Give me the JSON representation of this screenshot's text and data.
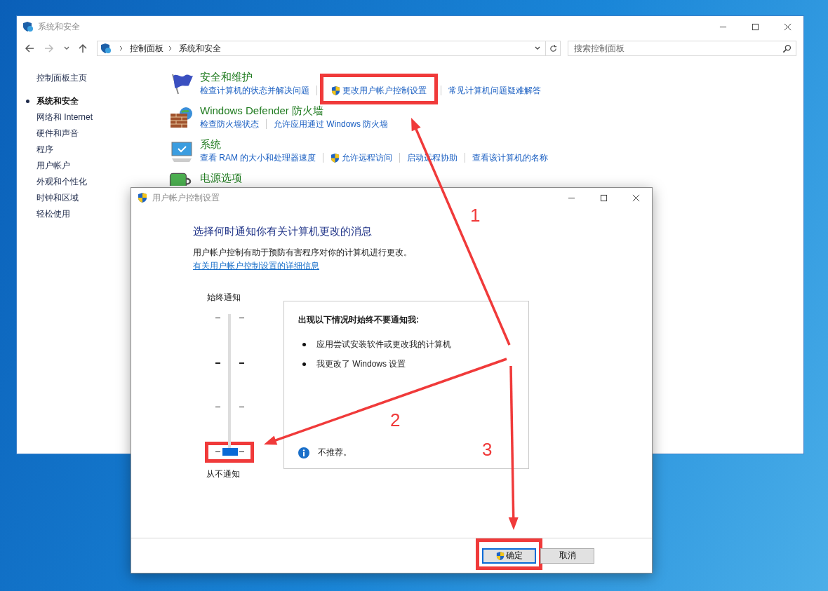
{
  "control_panel": {
    "title": "系统和安全",
    "breadcrumb": [
      "控制面板",
      "系统和安全"
    ],
    "search": {
      "placeholder": "搜索控制面板"
    },
    "sidebar": {
      "items": [
        {
          "label": "控制面板主页",
          "selected": false
        },
        {
          "label": "系统和安全",
          "selected": true
        },
        {
          "label": "网络和 Internet",
          "selected": false
        },
        {
          "label": "硬件和声音",
          "selected": false
        },
        {
          "label": "程序",
          "selected": false
        },
        {
          "label": "用户帐户",
          "selected": false
        },
        {
          "label": "外观和个性化",
          "selected": false
        },
        {
          "label": "时钟和区域",
          "selected": false
        },
        {
          "label": "轻松使用",
          "selected": false
        }
      ]
    },
    "categories": [
      {
        "kind": "flag",
        "title": "安全和维护",
        "links": [
          {
            "text": "检查计算机的状态并解决问题",
            "shield": false,
            "highlighted": false
          },
          {
            "text": "更改用户帐户控制设置",
            "shield": true,
            "highlighted": true
          },
          {
            "text": "常见计算机问题疑难解答",
            "shield": false,
            "highlighted": false
          }
        ]
      },
      {
        "kind": "firewall",
        "title": "Windows Defender 防火墙",
        "links": [
          {
            "text": "检查防火墙状态",
            "shield": false,
            "highlighted": false
          },
          {
            "text": "允许应用通过 Windows 防火墙",
            "shield": false,
            "highlighted": false
          }
        ]
      },
      {
        "kind": "monitor",
        "title": "系统",
        "links": [
          {
            "text": "查看 RAM 的大小和处理器速度",
            "shield": false,
            "highlighted": false
          },
          {
            "text": "允许远程访问",
            "shield": true,
            "highlighted": false
          },
          {
            "text": "启动远程协助",
            "shield": false,
            "highlighted": false
          },
          {
            "text": "查看该计算机的名称",
            "shield": false,
            "highlighted": false
          }
        ]
      },
      {
        "kind": "battery",
        "title": "电源选项"
      }
    ]
  },
  "uac_dialog": {
    "title": "用户帐户控制设置",
    "heading": "选择何时通知你有关计算机更改的消息",
    "description": "用户帐户控制有助于预防有害程序对你的计算机进行更改。",
    "link": "有关用户帐户控制设置的详细信息",
    "slider": {
      "top_label": "始终通知",
      "bottom_label": "从不通知",
      "level": 0,
      "highlighted": true
    },
    "panel": {
      "title": "出现以下情况时始终不要通知我:",
      "bullets": [
        "应用尝试安装软件或更改我的计算机",
        "我更改了 Windows 设置"
      ],
      "note": "不推荐。"
    },
    "buttons": [
      {
        "label": "确定",
        "shield": true,
        "focused": true,
        "highlighted": true
      },
      {
        "label": "取消",
        "shield": false,
        "focused": false,
        "highlighted": false
      }
    ]
  },
  "annotations": [
    {
      "label": "1"
    },
    {
      "label": "2"
    },
    {
      "label": "3"
    }
  ]
}
